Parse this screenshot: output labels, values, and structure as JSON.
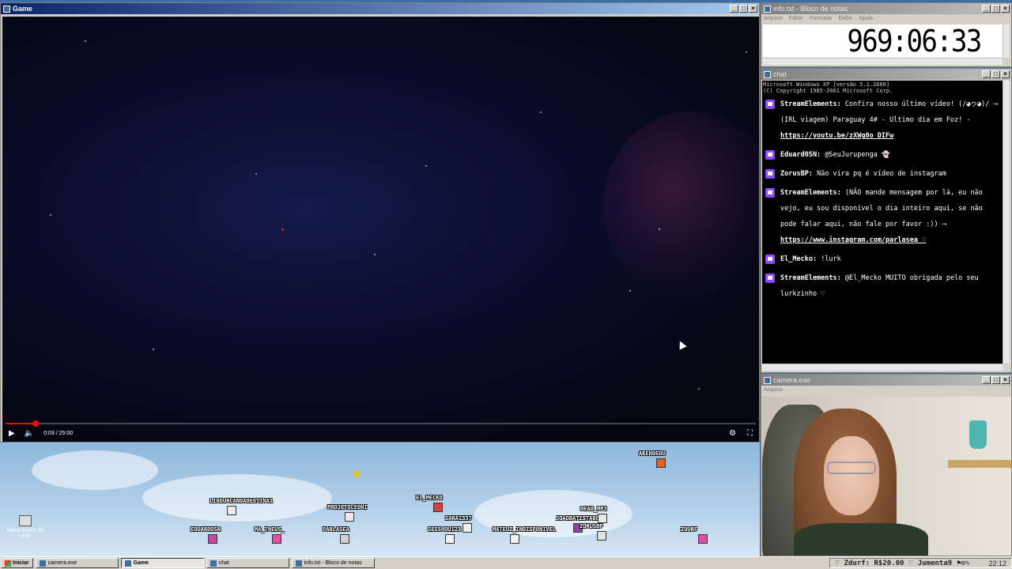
{
  "game_window": {
    "title": "Game",
    "player": {
      "time": "0:03 / 25:00",
      "progress": 0.002
    }
  },
  "overlay": {
    "avatars": [
      "LINDURCANDADESTINA1",
      "EDUARDOSN",
      "MA_THEUS_",
      "PROJETOLEONI",
      "PARLASEA",
      "EL_MECKO",
      "SARA1337",
      "SESSHOU123",
      "MATEUZ_INDISPONIVEL",
      "JOAOBATISTA001",
      "HEAD_MP3",
      "ZORUSBP",
      "AKENOEDU",
      "ZDURF"
    ],
    "desktop_icon": "Meus locais de rede"
  },
  "notepad": {
    "title": "info.txt - Bloco de notas",
    "menu": [
      "Arquivo",
      "Editar",
      "Formatar",
      "Exibir",
      "Ajuda"
    ],
    "timer": "969:06:33"
  },
  "chat": {
    "title": "chat",
    "header_lines": [
      "Microsoft Windows XP [versão 5.1.2600]",
      "(C) Copyright 1985-2001 Microsoft Corp."
    ],
    "messages": [
      {
        "user": "StreamElements:",
        "text": "Confira nosso último vídeo! (/◕ヮ◕)/ ⟶ (IRL viagem) Paraguay 4# - Ultimo dia em Foz! -",
        "link": "https://youtu.be/zXWg0o_DIFw"
      },
      {
        "user": "Eduard0SN:",
        "text": "@SeuJurupenga 👻",
        "link": ""
      },
      {
        "user": "ZorusBP:",
        "text": "Não vira pq é vídeo de instagram",
        "link": ""
      },
      {
        "user": "StreamElements:",
        "text": "(NÃO mande mensagem por lá, eu não vejo, eu sou disponível o dia inteiro aqui, se não pode falar aqui, não fale por favor :)) ⟶",
        "link": "https://www.instagram.com/parlasea ♡"
      },
      {
        "user": "El_Mecko:",
        "text": "!lurk",
        "link": ""
      },
      {
        "user": "StreamElements:",
        "text": "@El_Mecko MUITO obrigada pelo seu lurkzinho ♡",
        "link": ""
      }
    ]
  },
  "camera": {
    "title": "camera.exe",
    "menu": "Arquivo"
  },
  "taskbar": {
    "start": "Iniciar",
    "tasks": [
      {
        "label": "camera.exe",
        "active": false
      },
      {
        "label": "Game",
        "active": true
      },
      {
        "label": "chat",
        "active": false
      },
      {
        "label": "info.txt - Bloco de notas",
        "active": false
      }
    ],
    "tray_user": "Zdurf: R$20.00",
    "tray_user2": "Jumenta9",
    "clock": "22:12"
  },
  "colors": {
    "accent": "#0a246a",
    "twitch": "#9146ff",
    "progress": "#ff0000"
  }
}
